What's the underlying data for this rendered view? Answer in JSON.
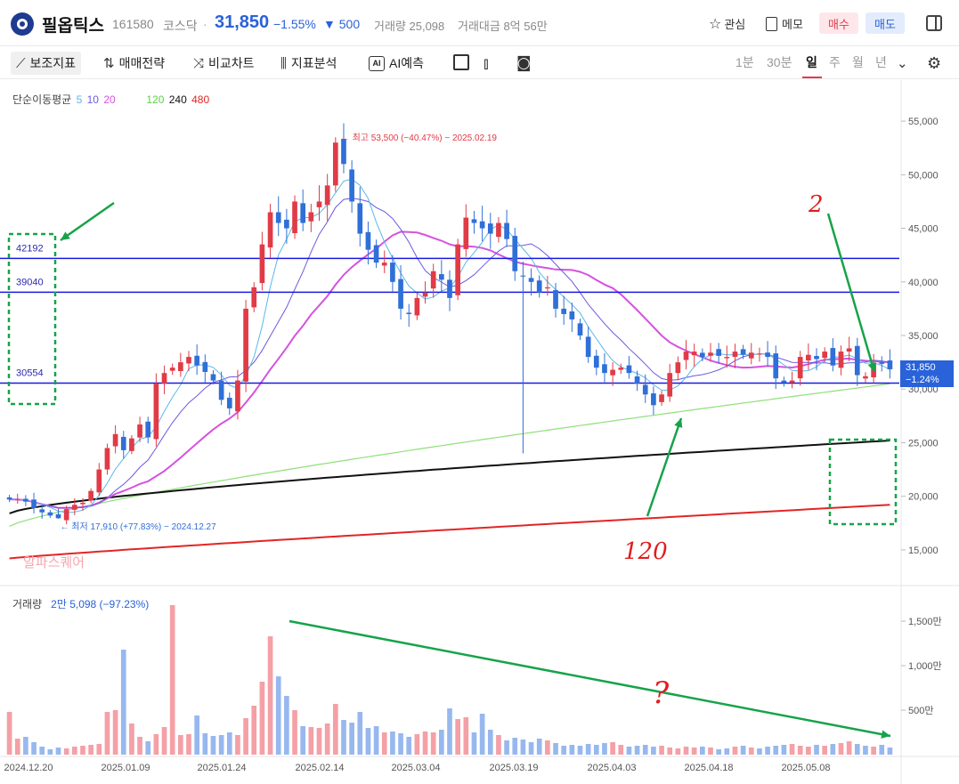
{
  "header": {
    "stock_name": "필옵틱스",
    "stock_code": "161580",
    "market": "코스닥",
    "separator": "·",
    "price": "31,850",
    "change_pct": "−1.55%",
    "change_amt": "▼ 500",
    "volume": "거래량 25,098",
    "trade_amount": "거래대금 8억 56만",
    "watch_label": "관심",
    "memo_label": "메모",
    "buy_label": "매수",
    "sell_label": "매도"
  },
  "toolbar": {
    "indicators": "보조지표",
    "strategy": "매매전략",
    "compare": "비교차트",
    "analysis": "지표분석",
    "ai_predict": "AI예측",
    "ai_badge": "AI",
    "periods": [
      "1분",
      "30분",
      "일",
      "주",
      "월",
      "년"
    ],
    "selected_period": "일"
  },
  "colors": {
    "up": "#e03b46",
    "down": "#2f6fd8",
    "ma5": "#5bb7ea",
    "ma10": "#6a5ae0",
    "ma20": "#d553e0",
    "ma120": "#8fe07a",
    "ma240": "#111111",
    "ma480": "#e32525",
    "hline": "#1a1ae0",
    "annot_green": "#16a34a",
    "annot_red": "#e11d1d"
  },
  "chart_data": {
    "type": "candlestick",
    "legend": {
      "title": "단순이동평균",
      "ma5": "5",
      "ma10": "10",
      "ma20": "20",
      "ma120": "120",
      "ma240": "240",
      "ma480": "480"
    },
    "y_ticks": [
      "55,000",
      "50,000",
      "45,000",
      "40,000",
      "35,000",
      "30,000",
      "25,000",
      "20,000",
      "15,000"
    ],
    "y_range": [
      12500,
      58000
    ],
    "x_ticks": [
      "2024.12.20",
      "2025.01.09",
      "2025.01.24",
      "2025.02.14",
      "2025.03.04",
      "2025.03.19",
      "2025.04.03",
      "2025.04.18",
      "2025.05.08"
    ],
    "horizontal_lines": [
      42192,
      39040,
      30554
    ],
    "hline_labels": [
      "42192",
      "39040",
      "30554"
    ],
    "current_price_tag": "31,850",
    "current_change_tag": "−1.24%",
    "high_annotation": "최고 53,500 (−40.47%) − 2025.02.19",
    "low_annotation": "최저 17,910 (+77.83%) − 2024.12.27",
    "watermark": "알파스퀘어",
    "handwritten": {
      "red_top": "2",
      "red_bottom": "120",
      "red_volume": "?"
    },
    "closes": [
      19700,
      19700,
      19500,
      18900,
      18500,
      18200,
      17950,
      18800,
      19200,
      19400,
      20500,
      22500,
      24500,
      25800,
      24300,
      25400,
      26700,
      25500,
      30500,
      31500,
      32000,
      32500,
      33000,
      32200,
      31600,
      30800,
      29000,
      28200,
      30800,
      37500,
      39500,
      43500,
      46500,
      45500,
      45000,
      47500,
      45500,
      46500,
      47500,
      49000,
      53000,
      51000,
      47500,
      44500,
      43000,
      41800,
      41800,
      40000,
      37500,
      37000,
      38500,
      39000,
      41000,
      40200,
      38500,
      43500,
      46000,
      45500,
      45000,
      44500,
      45500,
      44000,
      41000,
      40500,
      40000,
      39000,
      39500,
      37500,
      37000,
      36500,
      35000,
      33000,
      32000,
      31500,
      31800,
      32000,
      31500,
      30500,
      29500,
      28500,
      29500,
      31500,
      32500,
      33500,
      33500,
      33000,
      33400,
      33100,
      33000,
      33500,
      33200,
      33400,
      33300,
      33000,
      31000,
      30600,
      30800,
      33000,
      33200,
      32800,
      33500,
      32200,
      33500,
      33800,
      31300,
      31200,
      32400,
      32350,
      31850
    ],
    "ma_values": {
      "ma120_start": 17200,
      "ma120_end": 30500,
      "ma240_start": 18400,
      "ma240_end": 25200,
      "ma480_start": 14200,
      "ma480_end": 19200
    },
    "volume_legend_label": "거래량",
    "volume_legend_value": "2만 5,098 (−97.23%)",
    "volume_ticks": [
      "1,500만",
      "1,000만",
      "500만"
    ],
    "volume_max": 1800,
    "volumes": [
      480,
      180,
      200,
      140,
      90,
      60,
      80,
      70,
      90,
      100,
      110,
      120,
      480,
      500,
      1180,
      350,
      200,
      150,
      230,
      310,
      1680,
      220,
      230,
      440,
      240,
      210,
      220,
      250,
      220,
      410,
      550,
      820,
      1330,
      880,
      660,
      500,
      320,
      310,
      300,
      350,
      570,
      390,
      360,
      480,
      300,
      320,
      250,
      260,
      240,
      200,
      230,
      260,
      250,
      280,
      520,
      400,
      420,
      250,
      460,
      280,
      220,
      160,
      190,
      170,
      140,
      180,
      160,
      130,
      100,
      110,
      100,
      120,
      110,
      130,
      140,
      110,
      90,
      100,
      110,
      90,
      100,
      80,
      70,
      90,
      80,
      90,
      80,
      60,
      70,
      90,
      100,
      80,
      70,
      90,
      100,
      110,
      120,
      100,
      90,
      110,
      100,
      120,
      130,
      150,
      120,
      100,
      90,
      110,
      80
    ]
  }
}
